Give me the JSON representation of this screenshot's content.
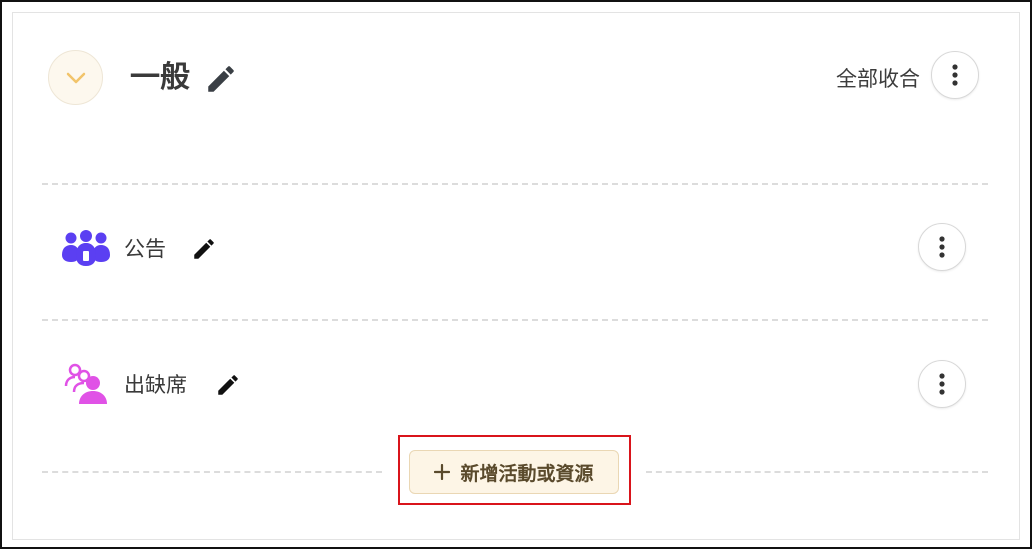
{
  "section": {
    "title": "一般",
    "collapse_all_label": "全部收合",
    "collapse_icon": "chevron-down-icon",
    "edit_icon": "pencil-icon",
    "menu_icon": "kebab-vertical-icon"
  },
  "activities": [
    {
      "label": "公告",
      "icon": "forum-people-icon",
      "icon_color": "#5b3ff2"
    },
    {
      "label": "出缺席",
      "icon": "attendance-people-icon",
      "icon_color": "#e052e6"
    }
  ],
  "add_activity": {
    "label": "新增活動或資源",
    "icon": "plus-icon"
  },
  "colors": {
    "accent_chevron": "#f2c46a",
    "highlight_border": "#d9141b",
    "add_button_bg": "#fdf5e6"
  }
}
